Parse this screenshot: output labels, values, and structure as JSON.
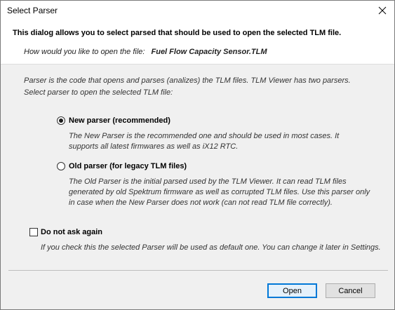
{
  "window": {
    "title": "Select Parser",
    "close_symbol": "✕"
  },
  "header": {
    "title": "This dialog allows you to select parsed that should be used to open the selected TLM file.",
    "question": "How would you like to open the file:",
    "filename": "Fuel Flow Capacity Sensor.TLM"
  },
  "info": {
    "line1": "Parser is the code that opens and parses (analizes) the TLM files. TLM Viewer has two parsers.",
    "line2": "Select parser to open the selected TLM file:"
  },
  "options": [
    {
      "label": "New parser (recommended)",
      "checked": true,
      "description": "The New Parser is the recommended one and should be used in most cases. It supports all latest firmwares as well as iX12 RTC."
    },
    {
      "label": "Old parser (for legacy TLM files)",
      "checked": false,
      "description": "The Old Parser is the initial parsed used by the TLM Viewer. It can read TLM files generated by old Spektrum firmware as well as corrupted TLM files. Use this parser only in case when the New Parser does not work (can not read TLM file correctly)."
    }
  ],
  "do_not_ask": {
    "label": "Do not ask again",
    "checked": false,
    "description": "If you check this the selected Parser will be used as default one. You can change it later in Settings."
  },
  "buttons": {
    "open": "Open",
    "cancel": "Cancel"
  }
}
